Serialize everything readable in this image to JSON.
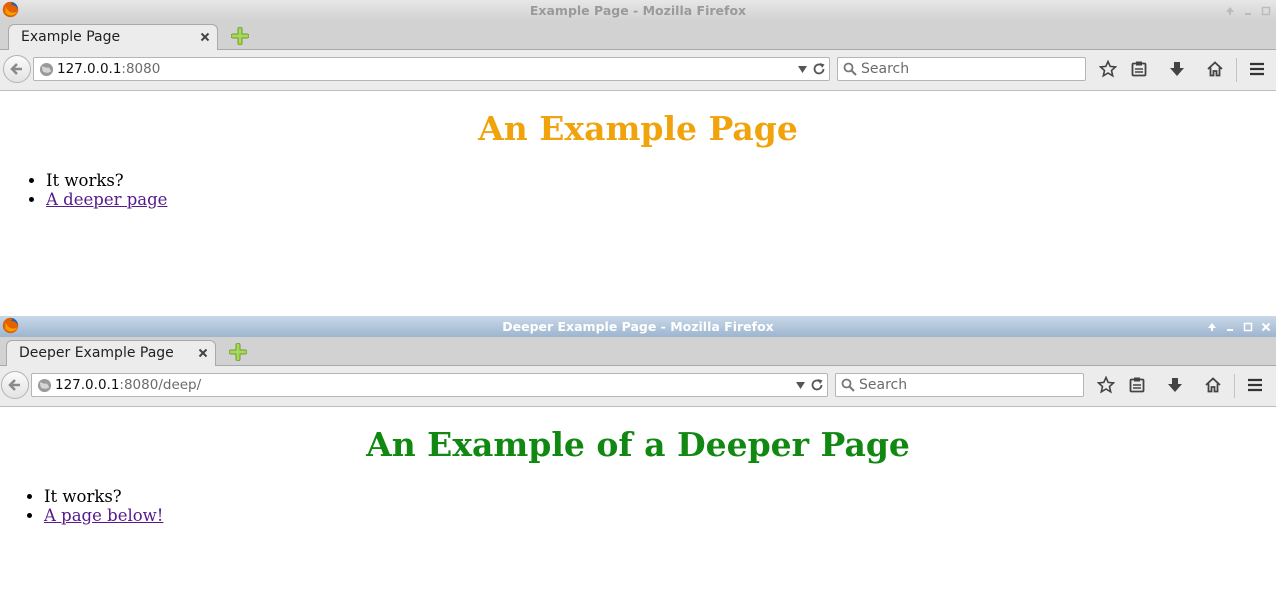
{
  "window1": {
    "title": "Example Page - Mozilla Firefox",
    "tab_title": "Example Page",
    "url_host": "127.0.0.1",
    "url_rest": ":8080",
    "search_placeholder": "Search",
    "heading": "An Example Page",
    "heading_color": "#f0a30a",
    "list": [
      "It works?",
      "A deeper page"
    ]
  },
  "window2": {
    "title": "Deeper Example Page - Mozilla Firefox",
    "tab_title": "Deeper Example Page",
    "url_host": "127.0.0.1",
    "url_rest": ":8080/deep/",
    "search_placeholder": "Search",
    "heading": "An Example of a Deeper Page",
    "heading_color": "#118811",
    "list": [
      "It works?",
      "A page below!"
    ]
  },
  "icons": [
    "firefox-logo-icon",
    "close-icon",
    "plus-icon",
    "back-arrow-icon",
    "globe-icon",
    "dropdown-arrow-icon",
    "reload-icon",
    "search-icon",
    "star-icon",
    "reading-list-icon",
    "download-icon",
    "home-icon",
    "hamburger-menu-icon",
    "maximize-icon",
    "minimize-icon",
    "restore-icon"
  ],
  "colors": {
    "link": "#551a8b",
    "active_titlebar": "#9db5cf",
    "inactive_titlebar": "#d2d2d2"
  }
}
